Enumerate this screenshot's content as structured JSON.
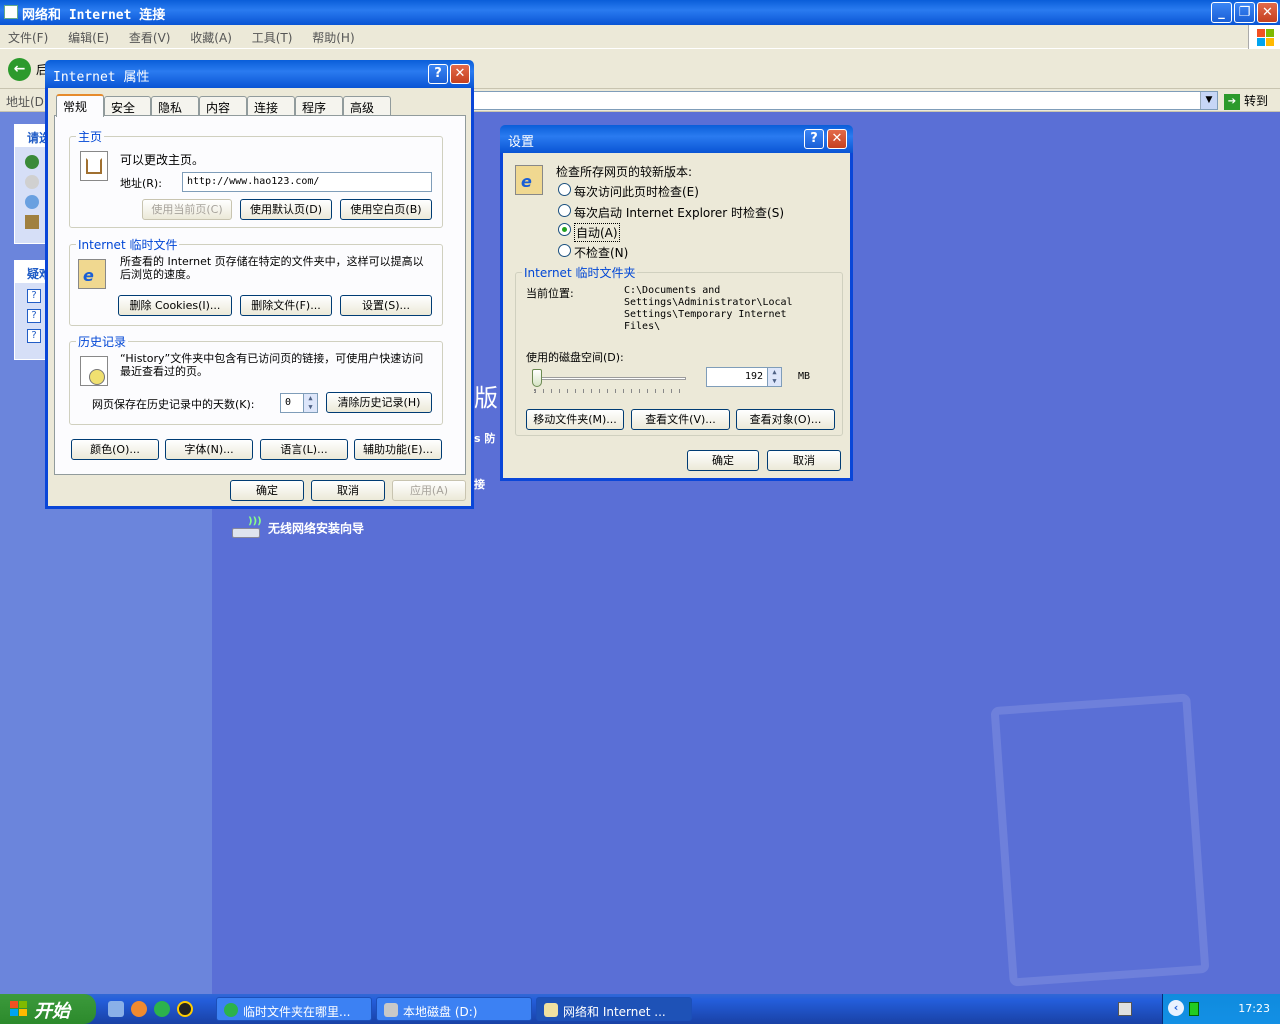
{
  "window": {
    "title": "网络和 Internet 连接"
  },
  "menu": [
    "文件(F)",
    "编辑(E)",
    "查看(V)",
    "收藏(A)",
    "工具(T)",
    "帮助(H)"
  ],
  "toolbar": {
    "back_partial": "后"
  },
  "address": {
    "label": "地址(D)",
    "go": "转到"
  },
  "left_pane": {
    "box1_header": "请选",
    "box2_header": "疑难"
  },
  "main_pane": {
    "wizard_label": "无线网络安装向导",
    "frag_ban": "版",
    "frag_fang": "s 防",
    "frag_jie": "接"
  },
  "internet_options": {
    "title": "Internet 属性",
    "tabs": [
      "常规",
      "安全",
      "隐私",
      "内容",
      "连接",
      "程序",
      "高级"
    ],
    "home": {
      "legend": "主页",
      "desc": "可以更改主页。",
      "addr_label": "地址(R):",
      "addr_value": "http://www.hao123.com/",
      "btn_current": "使用当前页(C)",
      "btn_default": "使用默认页(D)",
      "btn_blank": "使用空白页(B)"
    },
    "temp": {
      "legend": "Internet 临时文件",
      "desc": "所查看的 Internet 页存储在特定的文件夹中，这样可以提高以后浏览的速度。",
      "btn_cookies": "删除 Cookies(I)...",
      "btn_files": "删除文件(F)...",
      "btn_settings": "设置(S)..."
    },
    "history": {
      "legend": "历史记录",
      "desc": "“History”文件夹中包含有已访问页的链接，可使用户快速访问最近查看过的页。",
      "days_label": "网页保存在历史记录中的天数(K):",
      "days_value": "0",
      "btn_clear": "清除历史记录(H)"
    },
    "btn_colors": "颜色(O)...",
    "btn_fonts": "字体(N)...",
    "btn_languages": "语言(L)...",
    "btn_accessibility": "辅助功能(E)...",
    "btn_ok": "确定",
    "btn_cancel": "取消",
    "btn_apply": "应用(A)"
  },
  "settings": {
    "title": "设置",
    "check_label": "检查所存网页的较新版本:",
    "options": [
      "每次访问此页时检查(E)",
      "每次启动 Internet Explorer 时检查(S)",
      "自动(A)",
      "不检查(N)"
    ],
    "selected_option": "自动(A)",
    "temp_legend": "Internet 临时文件夹",
    "location_label": "当前位置:",
    "location_value_lines": [
      "C:\\Documents and",
      "Settings\\Administrator\\Local",
      "Settings\\Temporary Internet",
      "Files\\"
    ],
    "disk_label": "使用的磁盘空间(D):",
    "disk_value": "192",
    "disk_unit": "MB",
    "btn_move": "移动文件夹(M)...",
    "btn_view_files": "查看文件(V)...",
    "btn_view_objects": "查看对象(O)...",
    "btn_ok": "确定",
    "btn_cancel": "取消"
  },
  "taskbar": {
    "start": "开始",
    "items": [
      "临时文件夹在哪里...",
      "本地磁盘 (D:)",
      "网络和 Internet ..."
    ],
    "clock": "17:23"
  }
}
